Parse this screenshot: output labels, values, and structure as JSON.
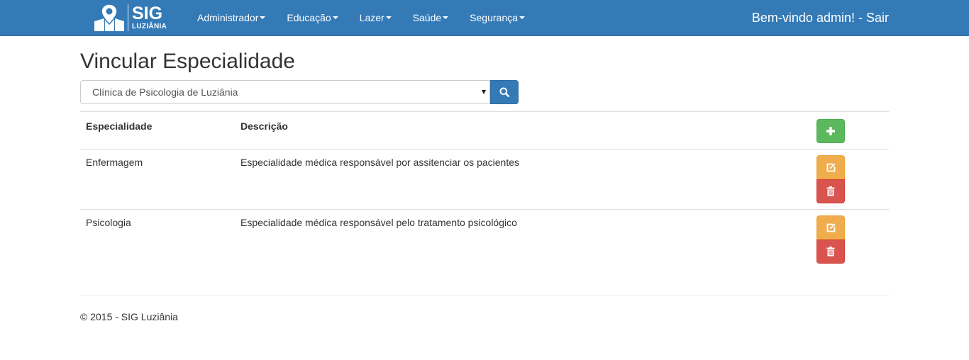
{
  "brand": {
    "title": "SIG",
    "subtitle": "LUZIÂNIA",
    "icon": "map-pin-logo-icon"
  },
  "nav": {
    "items": [
      {
        "label": "Administrador"
      },
      {
        "label": "Educação"
      },
      {
        "label": "Lazer"
      },
      {
        "label": "Saúde"
      },
      {
        "label": "Segurança"
      }
    ],
    "welcome_text": "Bem-vindo admin!",
    "separator": " - ",
    "logout_label": "Sair"
  },
  "page": {
    "title": "Vincular Especialidade"
  },
  "search": {
    "selected_value": "Clínica de Psicologia de Luziânia",
    "button_icon": "search-icon"
  },
  "table": {
    "headers": {
      "especialidade": "Especialidade",
      "descricao": "Descrição"
    },
    "add_icon": "plus-icon",
    "rows": [
      {
        "especialidade": "Enfermagem",
        "descricao": "Especialidade médica responsável por assitenciar os pacientes"
      },
      {
        "especialidade": "Psicologia",
        "descricao": "Especialidade médica responsável pelo tratamento psicológico"
      }
    ],
    "edit_icon": "edit-icon",
    "delete_icon": "trash-icon"
  },
  "footer": {
    "text": "© 2015 - SIG Luziânia"
  },
  "colors": {
    "navbar": "#337ab7",
    "primary": "#337ab7",
    "success": "#5cb85c",
    "warning": "#f0ad4e",
    "danger": "#d9534f"
  }
}
